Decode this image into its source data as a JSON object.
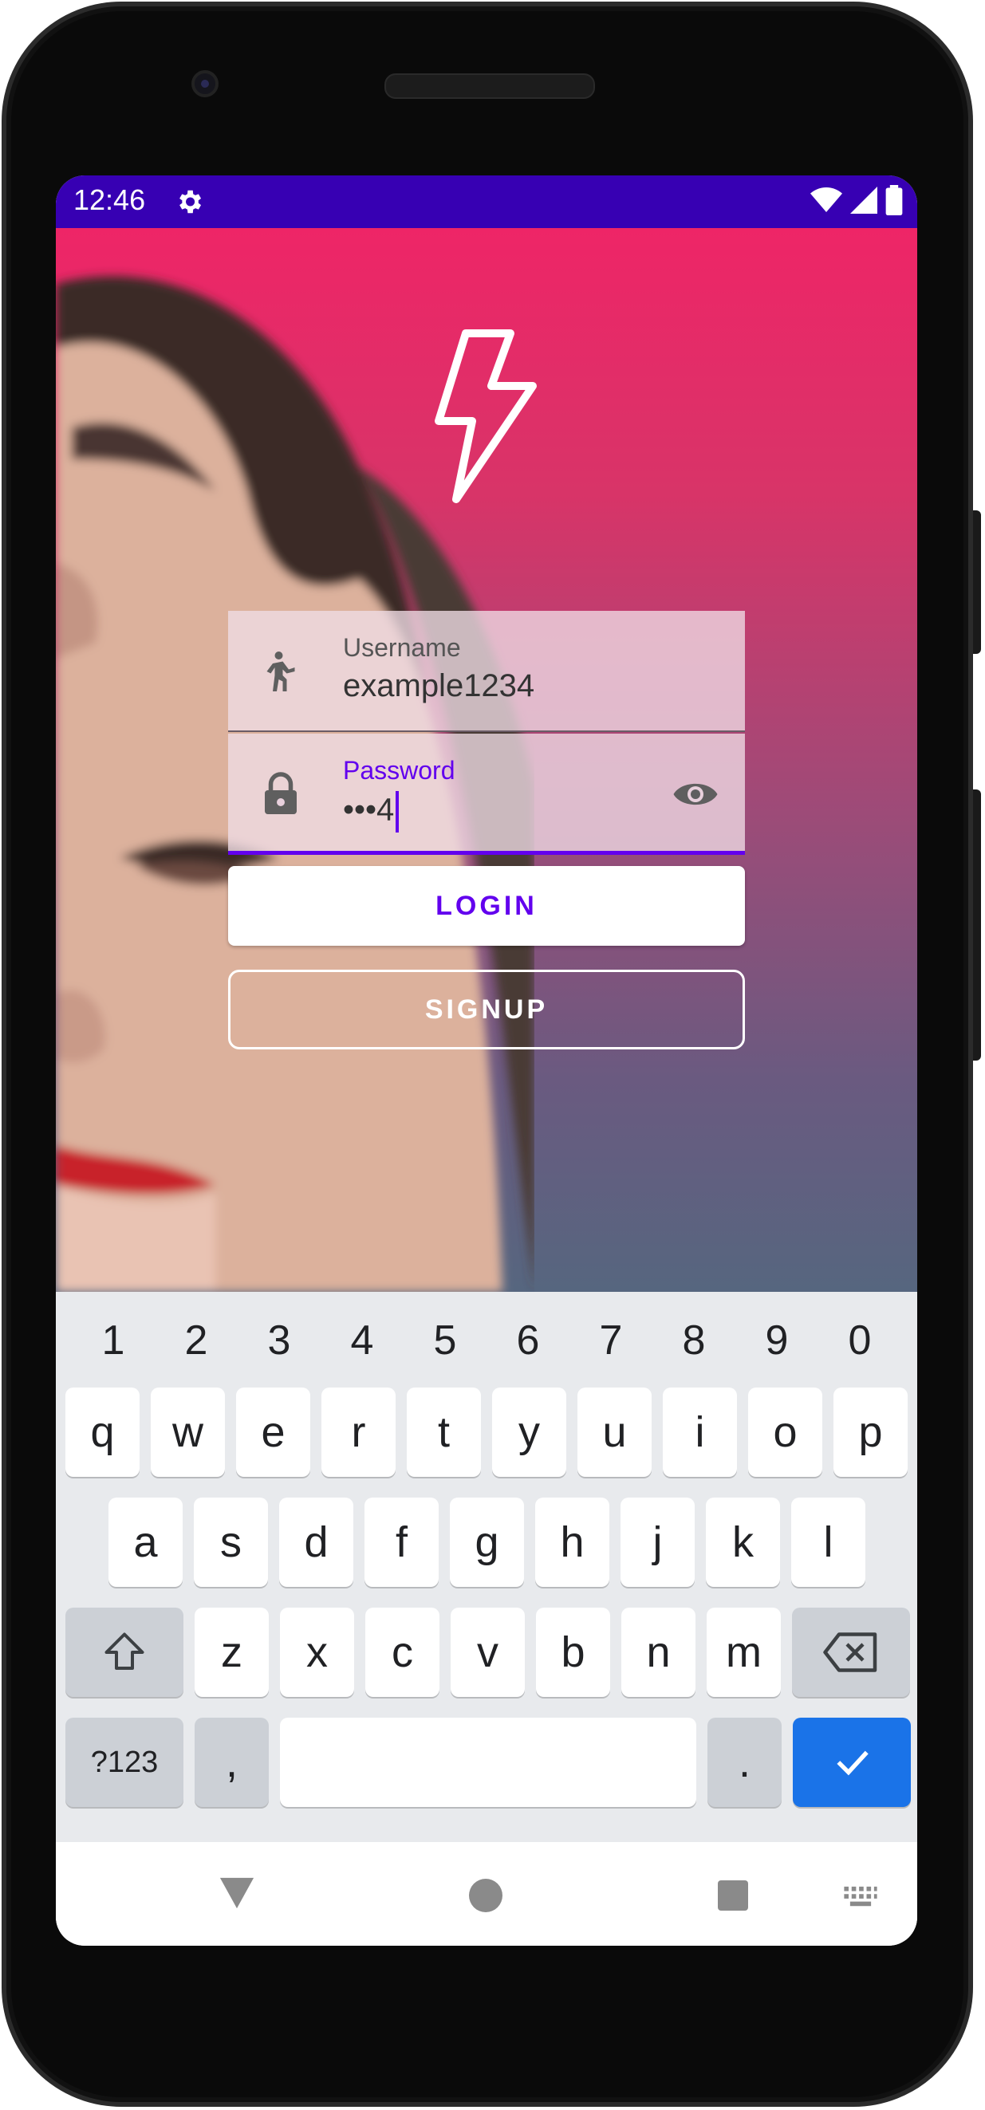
{
  "status_bar": {
    "time": "12:46",
    "background": "#3700b3",
    "icons": [
      "settings-gear-icon",
      "wifi-icon",
      "cellular-signal-icon",
      "battery-icon"
    ]
  },
  "app": {
    "logo": "lightning-bolt-icon",
    "background_gradient": [
      "#ee2567",
      "#56667f"
    ],
    "username": {
      "label": "Username",
      "value": "example1234",
      "icon": "person-walking-icon"
    },
    "password": {
      "label": "Password",
      "value": "•••4",
      "icon": "lock-icon",
      "toggle_icon": "eye-icon",
      "focused": true
    },
    "login_button": "LOGIN",
    "signup_button": "SIGNUP",
    "accent": "#6200ee"
  },
  "keyboard": {
    "number_row": [
      "1",
      "2",
      "3",
      "4",
      "5",
      "6",
      "7",
      "8",
      "9",
      "0"
    ],
    "row1": [
      "q",
      "w",
      "e",
      "r",
      "t",
      "y",
      "u",
      "i",
      "o",
      "p"
    ],
    "row2": [
      "a",
      "s",
      "d",
      "f",
      "g",
      "h",
      "j",
      "k",
      "l"
    ],
    "row3": [
      "z",
      "x",
      "c",
      "v",
      "b",
      "n",
      "m"
    ],
    "symbols_key": "?123",
    "comma_key": ",",
    "period_key": ".",
    "enter_color": "#1a73e8"
  },
  "nav_bar": {
    "icons": [
      "back-icon",
      "home-icon",
      "recents-icon",
      "keyboard-switch-icon"
    ]
  }
}
